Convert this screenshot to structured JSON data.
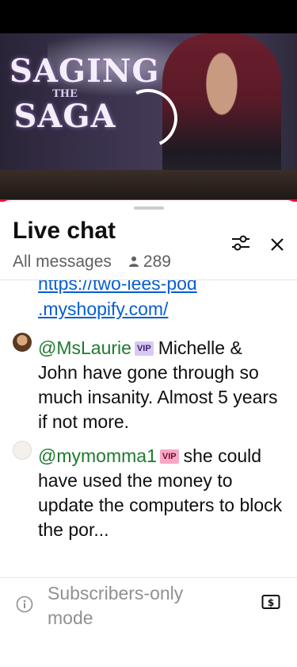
{
  "video": {
    "title_line1": "SAGING",
    "title_line2": "THE",
    "title_line3": "SAGA"
  },
  "chat": {
    "title": "Live chat",
    "filter_label": "All messages",
    "viewer_count": "289"
  },
  "messages": {
    "link_line1": "https://two-lees-pod",
    "link_line2": ".myshopify.com/",
    "items": [
      {
        "author": "@MsLaurie",
        "badge": "VIP",
        "badge_color": "#d9c9f2",
        "text": "Michelle & John have gone through so much insanity. Almost 5 years if not more."
      },
      {
        "author": "@mymomma1",
        "badge": "VIP",
        "badge_color": "#f7a8c4",
        "text": "she could have used the money to update the computers to block the por..."
      }
    ]
  },
  "footer": {
    "mode_text": "Subscribers-only mode",
    "superchat_symbol": "$"
  },
  "colors": {
    "author": "#1f7a2e",
    "link": "#065fd4",
    "progress": "#ff0033"
  }
}
